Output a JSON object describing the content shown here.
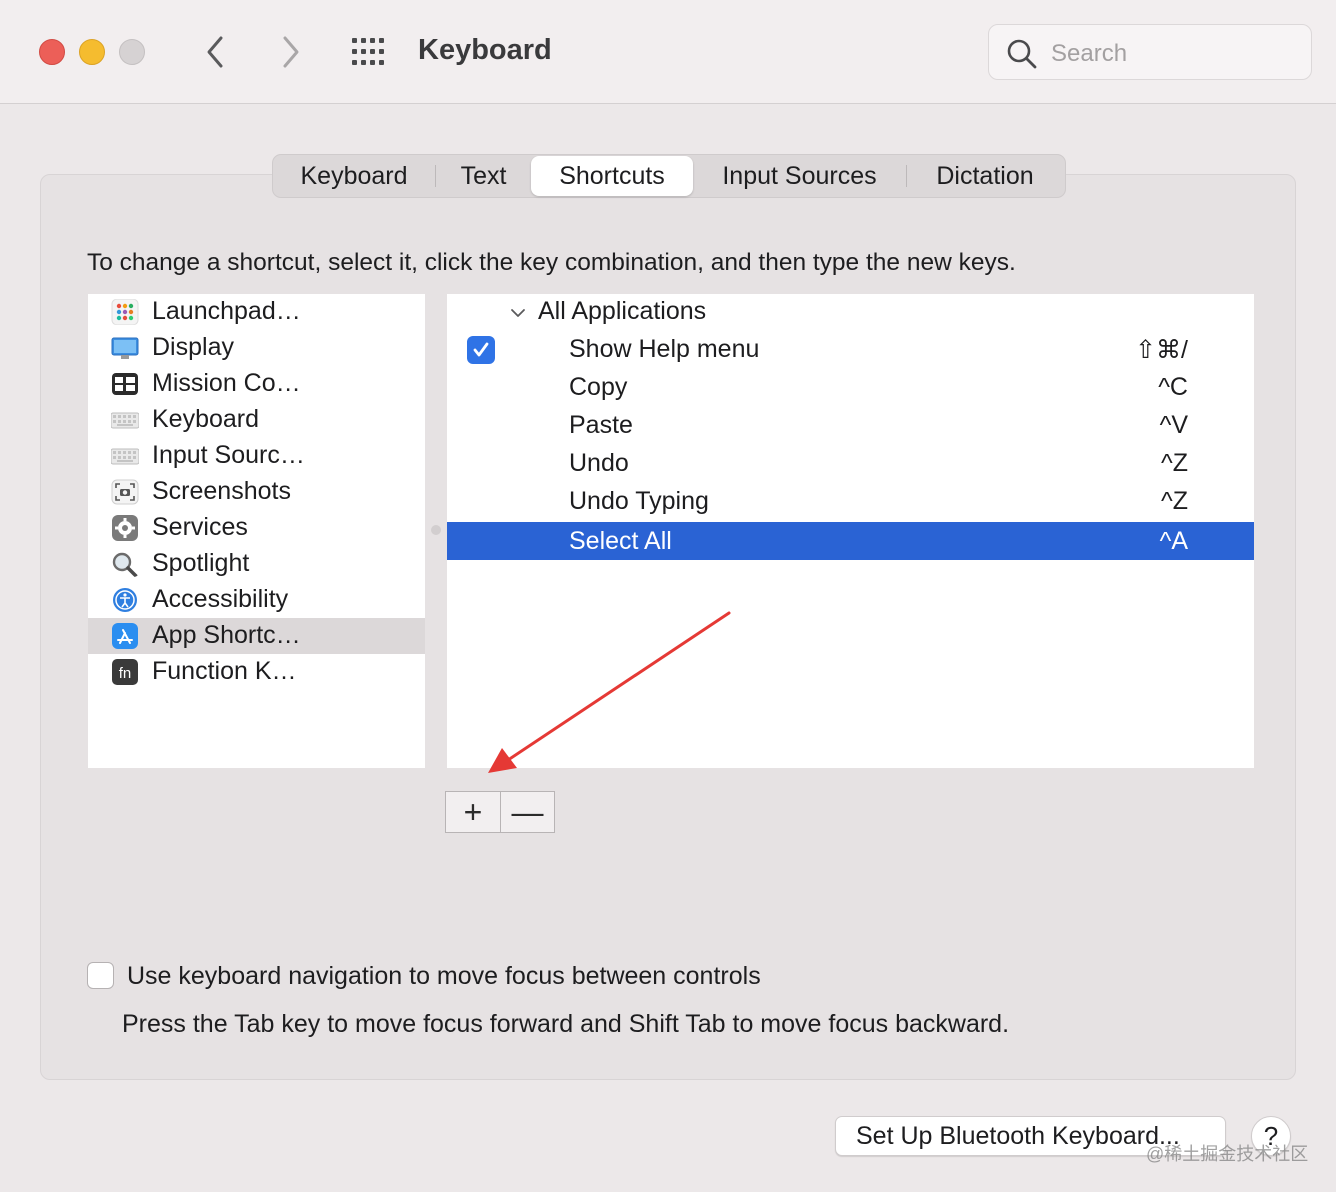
{
  "window": {
    "title": "Keyboard",
    "search_placeholder": "Search"
  },
  "tabs": [
    {
      "label": "Keyboard",
      "active": false
    },
    {
      "label": "Text",
      "active": false
    },
    {
      "label": "Shortcuts",
      "active": true
    },
    {
      "label": "Input Sources",
      "active": false
    },
    {
      "label": "Dictation",
      "active": false
    }
  ],
  "instructions": "To change a shortcut, select it, click the key combination, and then type the new keys.",
  "categories": [
    {
      "label": "Launchpad…",
      "icon": "launchpad-icon"
    },
    {
      "label": "Display",
      "icon": "display-icon"
    },
    {
      "label": "Mission Co…",
      "icon": "mission-control-icon"
    },
    {
      "label": "Keyboard",
      "icon": "keyboard-icon"
    },
    {
      "label": "Input Sourc…",
      "icon": "input-sources-icon"
    },
    {
      "label": "Screenshots",
      "icon": "screenshots-icon"
    },
    {
      "label": "Services",
      "icon": "services-gear-icon"
    },
    {
      "label": "Spotlight",
      "icon": "spotlight-magnifier-icon"
    },
    {
      "label": "Accessibility",
      "icon": "accessibility-icon"
    },
    {
      "label": "App Shortc…",
      "icon": "app-store-icon",
      "selected": true
    },
    {
      "label": "Function K…",
      "icon": "fn-key-icon"
    }
  ],
  "shortcuts": {
    "group_label": "All Applications",
    "items": [
      {
        "name": "Show Help menu",
        "keys": "⇧⌘/",
        "checked": true
      },
      {
        "name": "Copy",
        "keys": "^C"
      },
      {
        "name": "Paste",
        "keys": "^V"
      },
      {
        "name": "Undo",
        "keys": "^Z"
      },
      {
        "name": "Undo Typing",
        "keys": "^Z"
      },
      {
        "name": "Select All",
        "keys": "^A",
        "selected": true
      }
    ]
  },
  "buttons": {
    "add": "+",
    "remove": "—",
    "bluetooth": "Set Up Bluetooth Keyboard...",
    "help": "?"
  },
  "keyboard_navigation": {
    "label": "Use keyboard navigation to move focus between controls",
    "hint": "Press the Tab key to move focus forward and Shift Tab to move focus backward.",
    "checked": false
  },
  "watermark": "@稀土掘金技术社区",
  "colors": {
    "selection": "#2a63d4",
    "checkbox": "#2f73e6",
    "annotation_arrow": "#e53935"
  }
}
